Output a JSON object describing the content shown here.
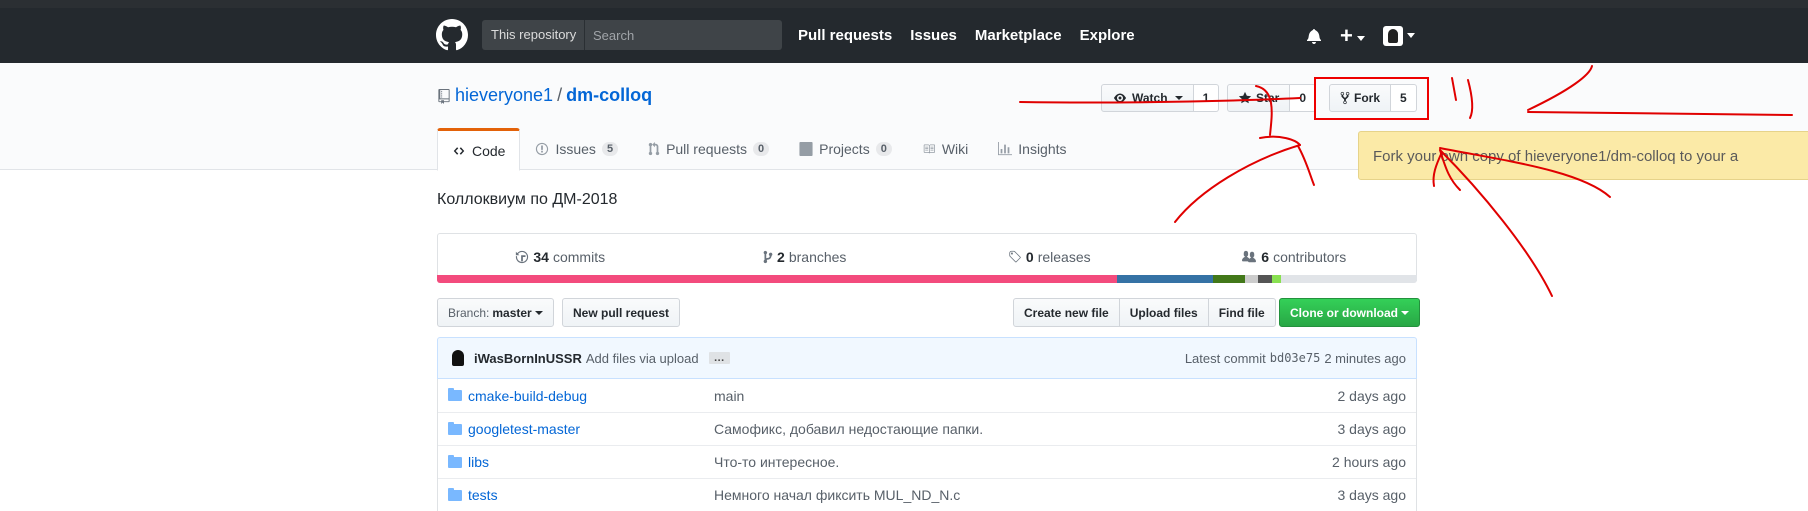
{
  "header": {
    "search_scope": "This repository",
    "search_placeholder": "Search",
    "nav": [
      "Pull requests",
      "Issues",
      "Marketplace",
      "Explore"
    ]
  },
  "repo": {
    "owner": "hieveryone1",
    "separator": "/",
    "name": "dm-colloq",
    "watch_label": "Watch",
    "watch_count": "1",
    "star_label": "Star",
    "star_count": "0",
    "fork_label": "Fork",
    "fork_count": "5",
    "description": "Коллоквиум по ДМ-2018"
  },
  "tabs": [
    {
      "label": "Code"
    },
    {
      "label": "Issues",
      "counter": "5"
    },
    {
      "label": "Pull requests",
      "counter": "0"
    },
    {
      "label": "Projects",
      "counter": "0"
    },
    {
      "label": "Wiki"
    },
    {
      "label": "Insights"
    }
  ],
  "tooltip": "Fork your own copy of hieveryone1/dm-colloq to your a",
  "summary": {
    "commits_num": "34",
    "commits_label": "commits",
    "branches_num": "2",
    "branches_label": "branches",
    "releases_num": "0",
    "releases_label": "releases",
    "contributors_num": "6",
    "contributors_label": "contributors"
  },
  "languages": [
    {
      "color": "#f34b7d",
      "share": 0.694
    },
    {
      "color": "#3572a5",
      "share": 0.098
    },
    {
      "color": "#427819",
      "share": 0.032
    },
    {
      "color": "#cccccc",
      "share": 0.014
    },
    {
      "color": "#555555",
      "share": 0.014
    },
    {
      "color": "#89e051",
      "share": 0.009
    },
    {
      "color": "#e1e4e8",
      "share": 0.139
    }
  ],
  "filenav": {
    "branch_label": "Branch:",
    "branch": "master",
    "new_pr": "New pull request",
    "create_file": "Create new file",
    "upload_files": "Upload files",
    "find_file": "Find file",
    "clone": "Clone or download"
  },
  "commit": {
    "author": "iWasBornInUSSR",
    "message": "Add files via upload",
    "ellipsis": "…",
    "latest": "Latest commit",
    "sha": "bd03e75",
    "age": "2 minutes ago"
  },
  "files": [
    {
      "name": "cmake-build-debug",
      "message": "main",
      "age": "2 days ago"
    },
    {
      "name": "googletest-master",
      "message": "Самофикс, добавил недостающие папки.",
      "age": "3 days ago"
    },
    {
      "name": "libs",
      "message": "Что-то интересное.",
      "age": "2 hours ago"
    },
    {
      "name": "tests",
      "message": "Немного начал фиксить MUL_ND_N.c",
      "age": "3 days ago"
    }
  ],
  "colors": {
    "header_bg": "#24292e",
    "link": "#0366d6",
    "tab_accent": "#e36209",
    "clone_green": "#28a745",
    "annotation_red": "#e00000"
  }
}
